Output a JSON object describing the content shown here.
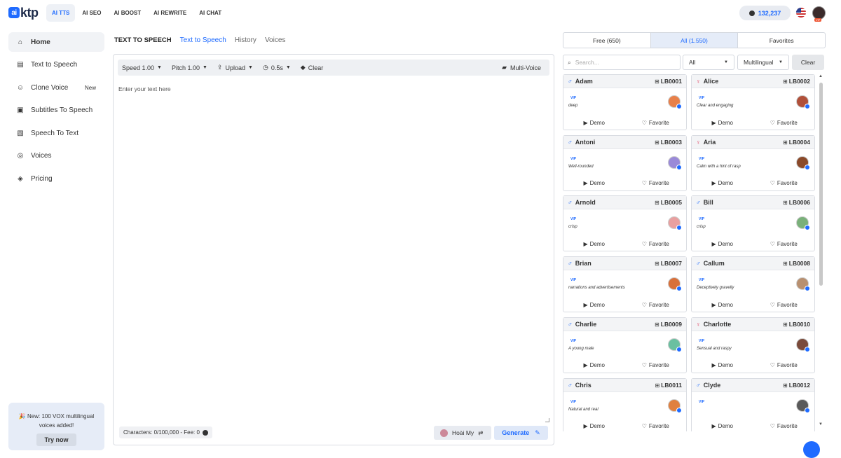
{
  "brand": {
    "logo": "ktp",
    "logo_mark": "ai"
  },
  "topnav": [
    {
      "label": "AI TTS",
      "active": true
    },
    {
      "label": "AI SEO"
    },
    {
      "label": "AI BOOST"
    },
    {
      "label": "AI REWRITE"
    },
    {
      "label": "AI CHAT"
    }
  ],
  "header": {
    "credits": "132,237",
    "avatar_badge": "VIP"
  },
  "sidebar": {
    "items": [
      {
        "label": "Home",
        "icon": "home-icon",
        "active": true
      },
      {
        "label": "Text to Speech",
        "icon": "document-icon"
      },
      {
        "label": "Clone Voice",
        "icon": "user-clone-icon",
        "badge": "New"
      },
      {
        "label": "Subtitles To Speech",
        "icon": "subtitles-icon"
      },
      {
        "label": "Speech To Text",
        "icon": "transcript-icon"
      },
      {
        "label": "Voices",
        "icon": "voices-icon"
      },
      {
        "label": "Pricing",
        "icon": "tag-icon"
      }
    ]
  },
  "promo": {
    "line1": "New: 100 VOX multilingual",
    "line2": "voices added!",
    "button": "Try now"
  },
  "tabs": {
    "section": "TEXT TO SPEECH",
    "items": [
      "Text to Speech",
      "History",
      "Voices"
    ]
  },
  "editor": {
    "speed": "Speed 1.00",
    "pitch": "Pitch 1.00",
    "upload": "Upload",
    "pause": "0.5s",
    "clear": "Clear",
    "multi_voice": "Multi-Voice",
    "placeholder": "Enter your text here",
    "char_count": "Characters: 0/100,000 - Fee: 0",
    "voice_selected": "Hoài My",
    "generate": "Generate"
  },
  "voice_tabs": [
    {
      "label": "Free (650)"
    },
    {
      "label": "All (1.550)",
      "active": true
    },
    {
      "label": "Favorites"
    }
  ],
  "filters": {
    "search_placeholder": "Search...",
    "category": "All",
    "language": "Multilingual",
    "clear": "Clear"
  },
  "card_labels": {
    "vip": "VIP",
    "demo": "Demo",
    "favorite": "Favorite"
  },
  "voices": [
    {
      "name": "Adam",
      "id": "LB0001",
      "gender": "male",
      "desc": "deep",
      "avatar_color": "#e8804a"
    },
    {
      "name": "Alice",
      "id": "LB0002",
      "gender": "female",
      "desc": "Clear and engaging",
      "avatar_color": "#b0503a"
    },
    {
      "name": "Antoni",
      "id": "LB0003",
      "gender": "male",
      "desc": "Well-rounded",
      "avatar_color": "#9a8ad8"
    },
    {
      "name": "Aria",
      "id": "LB0004",
      "gender": "female",
      "desc": "Calm with a hint of rasp",
      "avatar_color": "#8a4a2a"
    },
    {
      "name": "Arnold",
      "id": "LB0005",
      "gender": "male",
      "desc": "crisp",
      "avatar_color": "#e8a0a0"
    },
    {
      "name": "Bill",
      "id": "LB0006",
      "gender": "male",
      "desc": "crisp",
      "avatar_color": "#7ab07a"
    },
    {
      "name": "Brian",
      "id": "LB0007",
      "gender": "male",
      "desc": "narrations and advertisements",
      "avatar_color": "#d8703a"
    },
    {
      "name": "Callum",
      "id": "LB0008",
      "gender": "male",
      "desc": "Deceptively gravelly",
      "avatar_color": "#b89070"
    },
    {
      "name": "Charlie",
      "id": "LB0009",
      "gender": "male",
      "desc": "A young male",
      "avatar_color": "#6ac0a0"
    },
    {
      "name": "Charlotte",
      "id": "LB0010",
      "gender": "female",
      "desc": "Sensual and raspy",
      "avatar_color": "#7a4a3a"
    },
    {
      "name": "Chris",
      "id": "LB0011",
      "gender": "male",
      "desc": "Natural and real",
      "avatar_color": "#e08040"
    },
    {
      "name": "Clyde",
      "id": "LB0012",
      "gender": "male",
      "desc": "",
      "avatar_color": "#5a5a5a"
    }
  ],
  "colors": {
    "accent": "#1f6bff",
    "female": "#e04060"
  }
}
